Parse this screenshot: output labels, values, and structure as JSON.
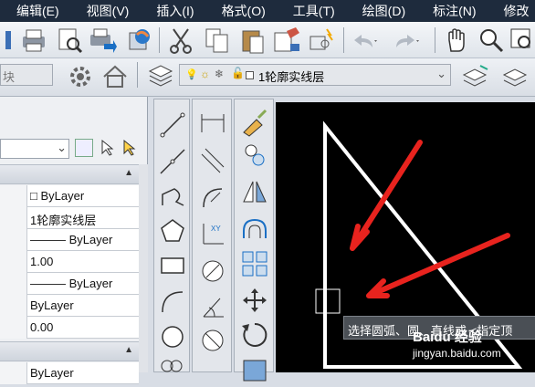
{
  "menu": {
    "items": [
      "编辑(E)",
      "视图(V)",
      "插入(I)",
      "格式(O)",
      "工具(T)",
      "绘图(D)",
      "标注(N)",
      "修改"
    ]
  },
  "layer": {
    "name": "1轮廓实线层",
    "left_combo_text": "块"
  },
  "properties": {
    "rows": [
      {
        "value": "ByLayer",
        "prefix": "□"
      },
      {
        "value": "1轮廓实线层"
      },
      {
        "value": "ByLayer",
        "prefix": "———"
      },
      {
        "value": "1.00"
      },
      {
        "value": "ByLayer",
        "prefix": "———"
      },
      {
        "value": "ByLayer"
      },
      {
        "value": "0.00"
      },
      {
        "value": "ByLayer"
      }
    ]
  },
  "canvas": {
    "tooltip": "选择圆弧、圆、直线或 <指定顶",
    "watermark_brand": "Baidu 经验",
    "watermark_url": "jingyan.baidu.com"
  },
  "colors": {
    "menubar": "#1e2b3d",
    "canvas": "#000000",
    "arrow": "#e8231e"
  }
}
